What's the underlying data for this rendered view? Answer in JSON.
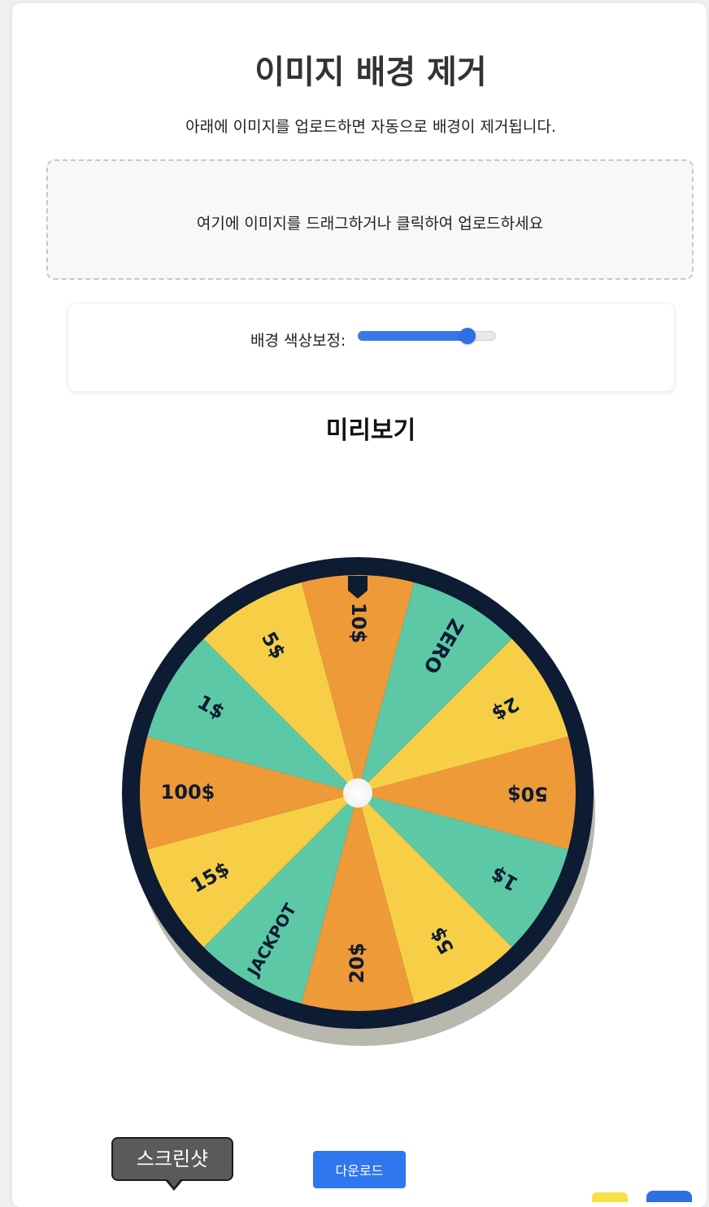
{
  "header": {
    "title": "이미지 배경 제거",
    "subtitle": "아래에 이미지를 업로드하면 자동으로 배경이 제거됩니다."
  },
  "upload": {
    "prompt": "여기에 이미지를 드래그하거나 클릭하여 업로드하세요"
  },
  "controls": {
    "slider_label": "배경 색상보정:",
    "slider_value": 0.8,
    "accent_color": "#2f6fe6"
  },
  "preview": {
    "title": "미리보기",
    "wheel_segments": [
      "10$",
      "ZERO",
      "2$",
      "50$",
      "1$",
      "5$",
      "20$",
      "JACKPOT",
      "15$",
      "100$",
      "1$",
      "5$"
    ],
    "segment_colors": [
      "#ef9a38",
      "#5cc8a6",
      "#f7cf46",
      "#ef9a38",
      "#5cc8a6",
      "#f7cf46",
      "#ef9a38",
      "#5cc8a6",
      "#f7cf46",
      "#ef9a38",
      "#5cc8a6",
      "#f7cf46"
    ],
    "rim_color": "#0d1b33"
  },
  "tooltip": {
    "text": "스크린샷"
  },
  "actions": {
    "download_label": "다운로드"
  }
}
